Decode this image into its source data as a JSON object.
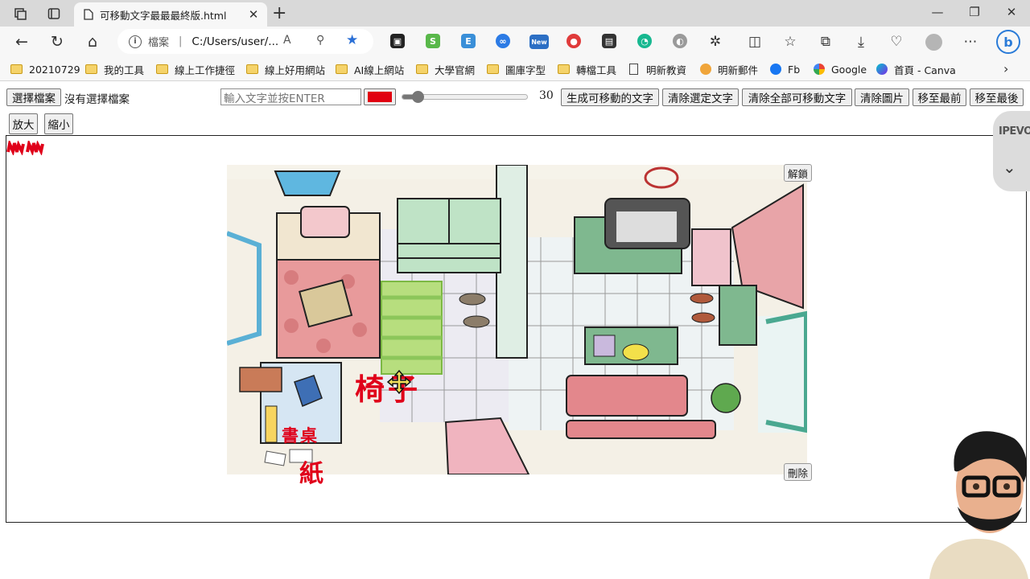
{
  "browser": {
    "tab_title": "可移動文字最最最終版.html",
    "address_protocol": "檔案",
    "address_url": "C:/Users/user/...",
    "new_badge": "New",
    "bing_label": "b"
  },
  "bookmarks": [
    {
      "label": "20210729",
      "icon": "folder-icon"
    },
    {
      "label": "我的工具",
      "icon": "folder-icon"
    },
    {
      "label": "線上工作捷徑",
      "icon": "folder-icon"
    },
    {
      "label": "線上好用網站",
      "icon": "folder-icon"
    },
    {
      "label": "AI線上網站",
      "icon": "folder-icon"
    },
    {
      "label": "大學官網",
      "icon": "folder-icon"
    },
    {
      "label": "圖庫字型",
      "icon": "folder-icon"
    },
    {
      "label": "轉檔工具",
      "icon": "folder-icon"
    },
    {
      "label": "明新教資",
      "icon": "page-icon"
    },
    {
      "label": "明新郵件",
      "icon": "mail-icon"
    },
    {
      "label": "Fb",
      "icon": "facebook-icon"
    },
    {
      "label": "Google",
      "icon": "google-icon"
    },
    {
      "label": "首頁 - Canva",
      "icon": "canva-icon"
    }
  ],
  "toolbar": {
    "choose_file": "選擇檔案",
    "no_file": "沒有選擇檔案",
    "text_placeholder": "輸入文字並按ENTER",
    "color_value": "#e10010",
    "font_size": "30",
    "font_size_fraction": 0.12,
    "create_text": "生成可移動的文字",
    "clear_selected": "清除選定文字",
    "clear_all": "清除全部可移動文字",
    "clear_image": "清除圖片",
    "move_front": "移至最前",
    "move_back": "移至最後",
    "zoom_in": "放大",
    "zoom_out": "縮小"
  },
  "canvas": {
    "unlock": "解鎖",
    "delete": "刪除",
    "labels": {
      "chair": "椅子",
      "desk": "書桌",
      "paper": "紙"
    }
  },
  "sidebar_widget": {
    "logo": "IPEVO"
  },
  "colors": {
    "accent_red": "#e0001a",
    "chrome_bg": "#f7f7f7",
    "tabstrip_bg": "#d9d9d9"
  }
}
